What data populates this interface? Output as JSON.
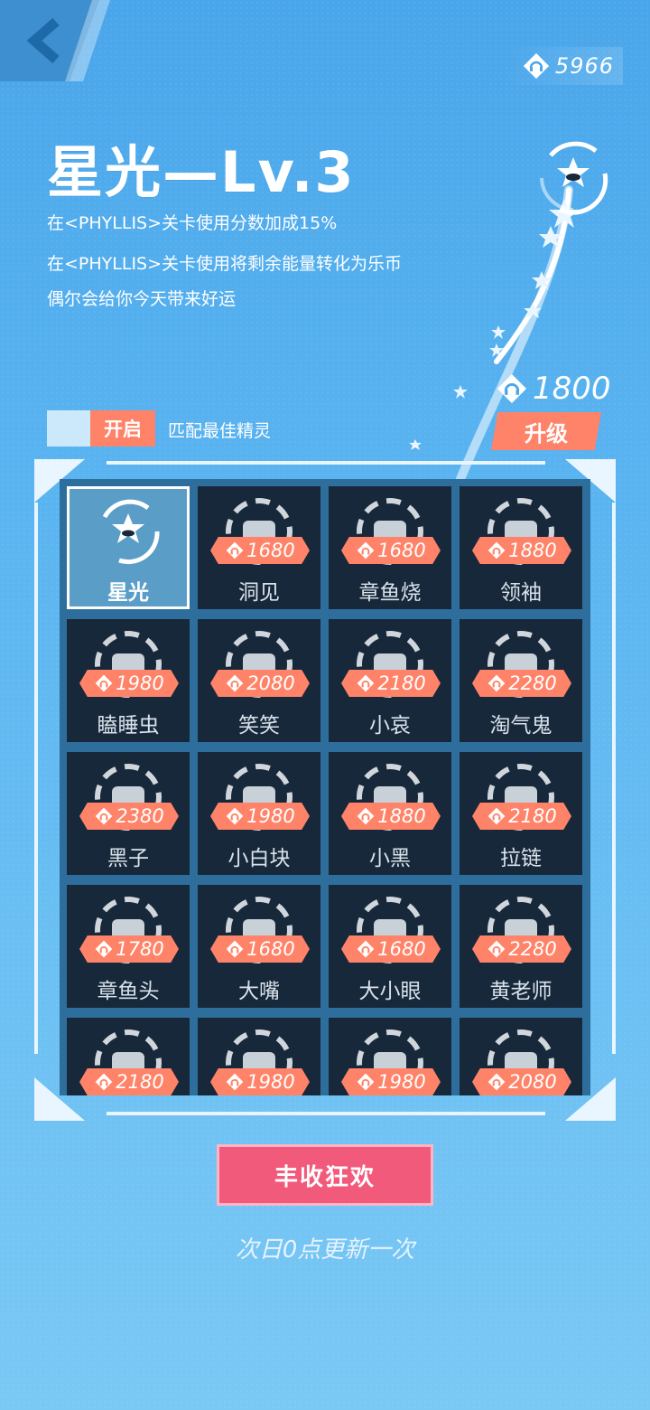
{
  "header": {
    "currency_amount": "5966"
  },
  "spirit": {
    "title": "星光—Lv.3",
    "descriptions": [
      "在<PHYLLIS>关卡使用分数加成15%",
      "在<PHYLLIS>关卡使用将剩余能量转化为乐币",
      "偶尔会给你今天带来好运"
    ]
  },
  "upgrade": {
    "cost": "1800",
    "button_label": "升级"
  },
  "auto_match": {
    "toggle_label": "开启",
    "label": "匹配最佳精灵"
  },
  "grid": {
    "items": [
      {
        "name": "星光",
        "price": "",
        "selected": true
      },
      {
        "name": "洞见",
        "price": "1680"
      },
      {
        "name": "章鱼烧",
        "price": "1680"
      },
      {
        "name": "领袖",
        "price": "1880"
      },
      {
        "name": "瞌睡虫",
        "price": "1980"
      },
      {
        "name": "笑笑",
        "price": "2080"
      },
      {
        "name": "小哀",
        "price": "2180"
      },
      {
        "name": "淘气鬼",
        "price": "2280"
      },
      {
        "name": "黑子",
        "price": "2380"
      },
      {
        "name": "小白块",
        "price": "1980"
      },
      {
        "name": "小黑",
        "price": "1880"
      },
      {
        "name": "拉链",
        "price": "2180"
      },
      {
        "name": "章鱼头",
        "price": "1780"
      },
      {
        "name": "大嘴",
        "price": "1680"
      },
      {
        "name": "大小眼",
        "price": "1680"
      },
      {
        "name": "黄老师",
        "price": "2280"
      },
      {
        "name": "",
        "price": "2180"
      },
      {
        "name": "",
        "price": "1980"
      },
      {
        "name": "",
        "price": "1980"
      },
      {
        "name": "",
        "price": "2080"
      }
    ]
  },
  "footer": {
    "harvest_button": "丰收狂欢",
    "refresh_note": "次日0点更新一次"
  },
  "colors": {
    "accent": "#ff8368",
    "harvest": "#f25a7c",
    "cell_bg": "#17283a"
  }
}
